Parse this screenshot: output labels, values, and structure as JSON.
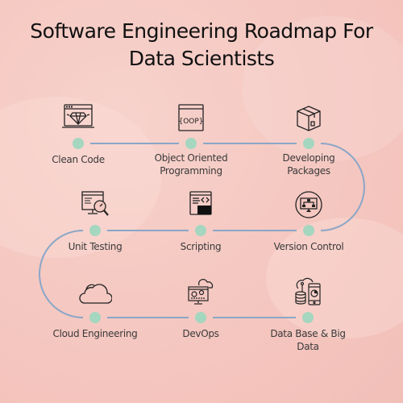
{
  "title": "Software Engineering Roadmap For Data Scientists",
  "title_line1": "Software Engineering Roadmap For",
  "title_line2": "Data Scientists",
  "colors": {
    "background": "#f5c9c2",
    "connector": "#8aa6c8",
    "dot": "#a5d6bf",
    "text": "#3a3a3a",
    "title": "#111111"
  },
  "steps": [
    {
      "label": "Clean Code",
      "icon": "diamond-window-icon"
    },
    {
      "label": "Object Oriented Programming",
      "icon": "oop-window-icon",
      "icon_text": "{OOP}"
    },
    {
      "label": "Developing Packages",
      "icon": "package-box-icon"
    },
    {
      "label": "Version Control",
      "icon": "version-control-monitor-icon"
    },
    {
      "label": "Scripting",
      "icon": "script-window-icon"
    },
    {
      "label": "Unit Testing",
      "icon": "monitor-magnifier-icon"
    },
    {
      "label": "Cloud Engineering",
      "icon": "cloud-icon"
    },
    {
      "label": "DevOps",
      "icon": "devops-gear-monitor-icon"
    },
    {
      "label": "Data Base & Big Data",
      "icon": "database-cloud-mobile-icon"
    }
  ]
}
